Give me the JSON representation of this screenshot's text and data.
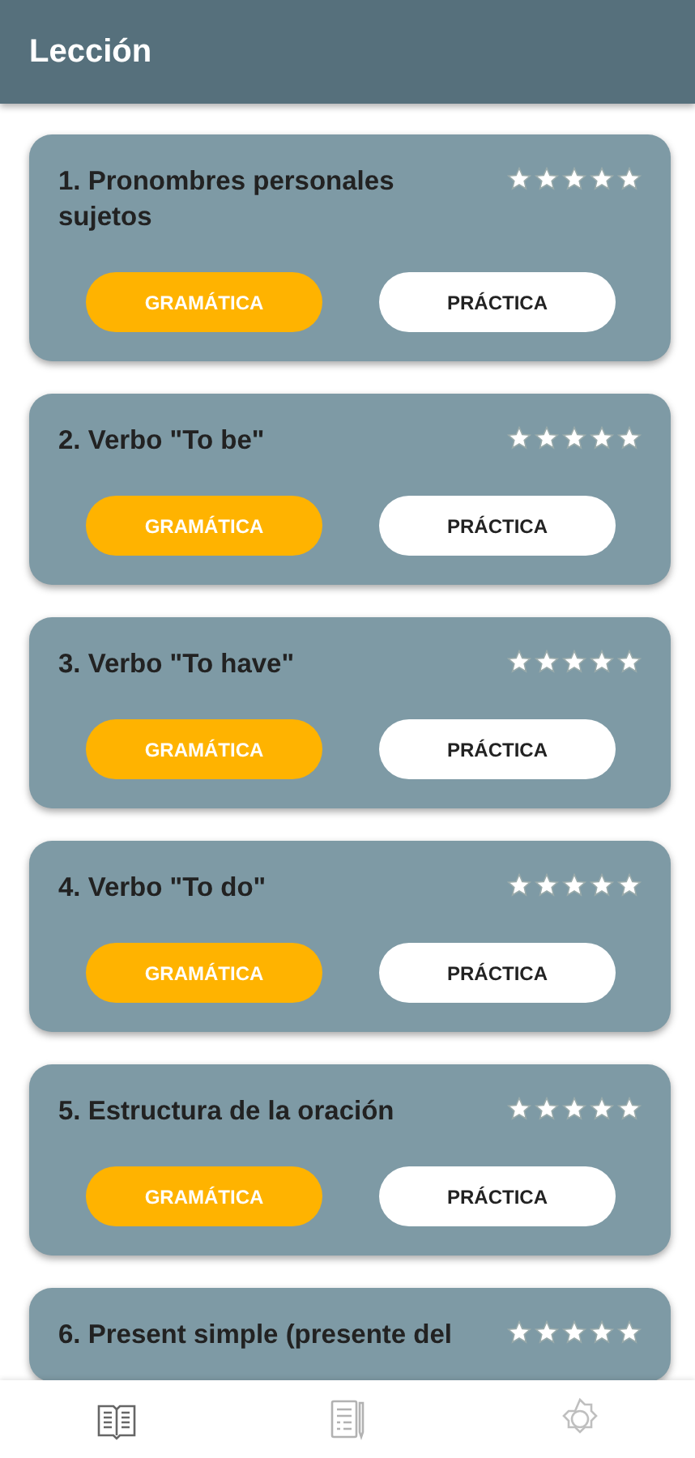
{
  "app_bar": {
    "title": "Lección"
  },
  "lessons": [
    {
      "title": "1. Pronombres personales sujetos",
      "stars": 5,
      "grammar_button": "GRAMÁTICA",
      "practice_button": "PRÁCTICA"
    },
    {
      "title": "2. Verbo \"To be\"",
      "stars": 5,
      "grammar_button": "GRAMÁTICA",
      "practice_button": "PRÁCTICA"
    },
    {
      "title": "3. Verbo \"To have\"",
      "stars": 5,
      "grammar_button": "GRAMÁTICA",
      "practice_button": "PRÁCTICA"
    },
    {
      "title": "4. Verbo \"To do\"",
      "stars": 5,
      "grammar_button": "GRAMÁTICA",
      "practice_button": "PRÁCTICA"
    },
    {
      "title": "5. Estructura de la oración",
      "stars": 5,
      "grammar_button": "GRAMÁTICA",
      "practice_button": "PRÁCTICA"
    },
    {
      "title": "6. Present simple (presente del",
      "stars": 5
    }
  ],
  "bottom_nav": [
    {
      "kind": "book",
      "selected": true
    },
    {
      "kind": "notes",
      "selected": false
    },
    {
      "kind": "settings",
      "selected": false
    }
  ]
}
